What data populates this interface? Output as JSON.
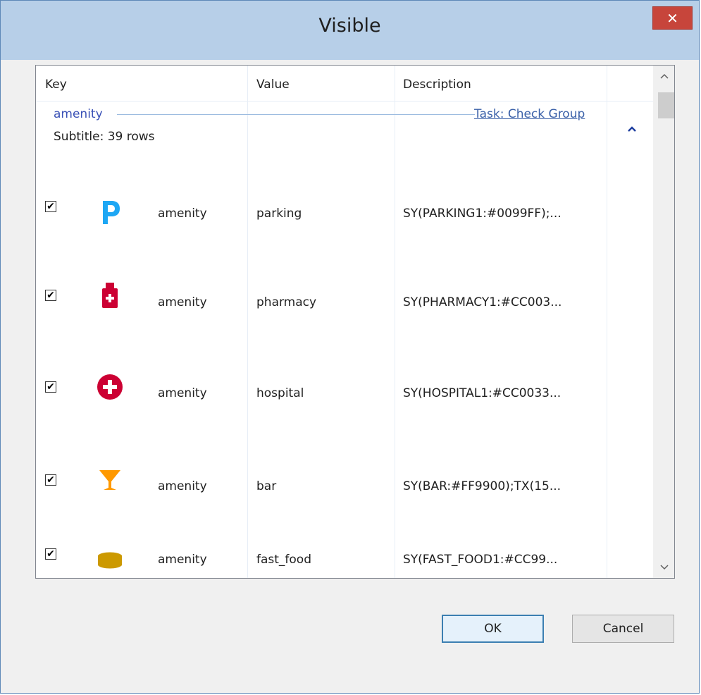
{
  "window": {
    "title": "Visible",
    "close_icon": "close-icon"
  },
  "grid": {
    "headers": {
      "key": "Key",
      "value": "Value",
      "description": "Description"
    },
    "group": {
      "name": "amenity",
      "task_link": "Task: Check Group",
      "subtitle": "Subtitle: 39 rows"
    },
    "rows": [
      {
        "checked": true,
        "icon": "parking-icon",
        "icon_color": "#0099FF",
        "key": "amenity",
        "value": "parking",
        "description": "SY(PARKING1:#0099FF);..."
      },
      {
        "checked": true,
        "icon": "pharmacy-icon",
        "icon_color": "#CC0033",
        "key": "amenity",
        "value": "pharmacy",
        "description": "SY(PHARMACY1:#CC003..."
      },
      {
        "checked": true,
        "icon": "hospital-icon",
        "icon_color": "#CC0033",
        "key": "amenity",
        "value": "hospital",
        "description": "SY(HOSPITAL1:#CC0033..."
      },
      {
        "checked": true,
        "icon": "bar-icon",
        "icon_color": "#FF9900",
        "key": "amenity",
        "value": "bar",
        "description": "SY(BAR:#FF9900);TX(15..."
      },
      {
        "checked": true,
        "icon": "fast-food-icon",
        "icon_color": "#CC9900",
        "key": "amenity",
        "value": "fast_food",
        "description": "SY(FAST_FOOD1:#CC99..."
      }
    ]
  },
  "buttons": {
    "ok": "OK",
    "cancel": "Cancel"
  }
}
